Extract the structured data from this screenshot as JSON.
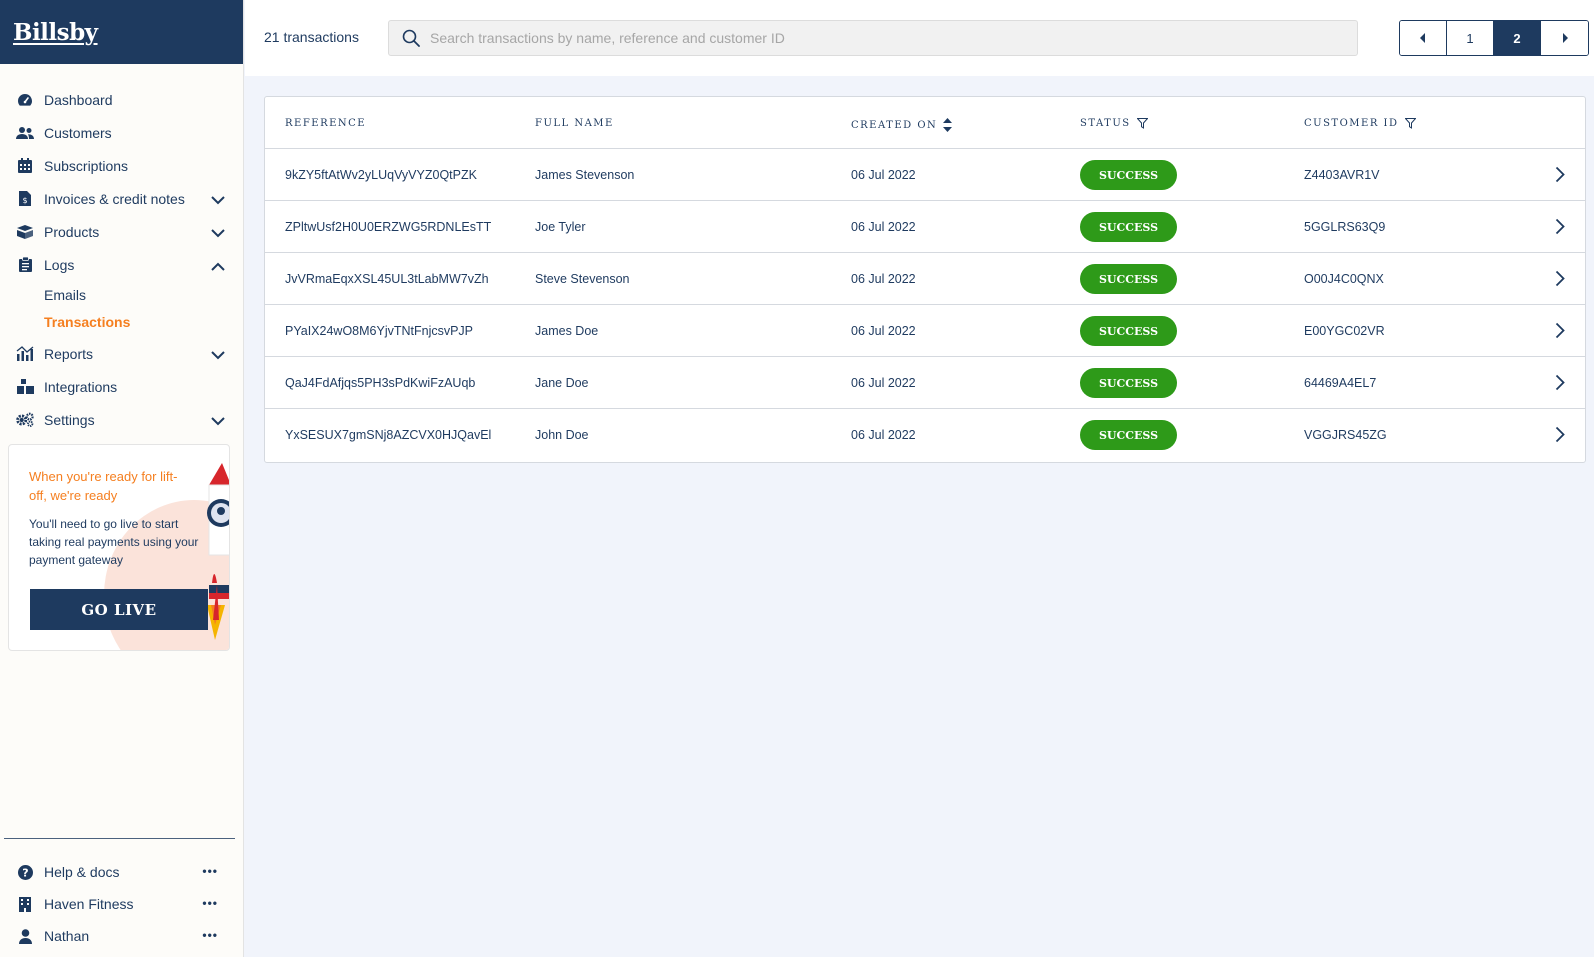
{
  "brand": {
    "name": "Billsby"
  },
  "sidebar": {
    "items": [
      {
        "label": "Dashboard",
        "icon": "dashboard-gauge-icon"
      },
      {
        "label": "Customers",
        "icon": "users-icon"
      },
      {
        "label": "Subscriptions",
        "icon": "calendar-icon"
      },
      {
        "label": "Invoices & credit notes",
        "icon": "invoice-icon",
        "expandable": true
      },
      {
        "label": "Products",
        "icon": "boxes-icon",
        "expandable": true
      },
      {
        "label": "Logs",
        "icon": "clipboard-icon",
        "expanded": true
      },
      {
        "label": "Reports",
        "icon": "chart-icon",
        "expandable": true
      },
      {
        "label": "Integrations",
        "icon": "puzzle-blocks-icon"
      },
      {
        "label": "Settings",
        "icon": "gears-icon",
        "expandable": true
      }
    ],
    "logs_sub": [
      {
        "label": "Emails",
        "active": false
      },
      {
        "label": "Transactions",
        "active": true
      }
    ],
    "promo": {
      "title": "When you're ready for lift-off, we're ready",
      "text": "You'll need to go live to start taking real payments using your payment gateway",
      "button": "GO LIVE"
    },
    "bottom": [
      {
        "label": "Help & docs",
        "icon": "question-circle-icon"
      },
      {
        "label": "Haven Fitness",
        "icon": "building-icon"
      },
      {
        "label": "Nathan",
        "icon": "user-icon"
      }
    ],
    "more_label": "•••"
  },
  "header": {
    "count_label": "21 transactions",
    "search_placeholder": "Search transactions by name, reference and customer ID",
    "pages": [
      "1",
      "2"
    ],
    "current_page": "2"
  },
  "table": {
    "columns": [
      "REFERENCE",
      "FULL NAME",
      "CREATED ON",
      "STATUS",
      "CUSTOMER ID"
    ],
    "rows": [
      {
        "reference": "9kZY5ftAtWv2yLUqVyVYZ0QtPZK",
        "name": "James Stevenson",
        "created": "06 Jul 2022",
        "status": "SUCCESS",
        "customer_id": "Z4403AVR1V"
      },
      {
        "reference": "ZPltwUsf2H0U0ERZWG5RDNLEsTT",
        "name": "Joe Tyler",
        "created": "06 Jul 2022",
        "status": "SUCCESS",
        "customer_id": "5GGLRS63Q9"
      },
      {
        "reference": "JvVRmaEqxXSL45UL3tLabMW7vZh",
        "name": "Steve Stevenson",
        "created": "06 Jul 2022",
        "status": "SUCCESS",
        "customer_id": "O00J4C0QNX"
      },
      {
        "reference": "PYaIX24wO8M6YjvTNtFnjcsvPJP",
        "name": "James Doe",
        "created": "06 Jul 2022",
        "status": "SUCCESS",
        "customer_id": "E00YGC02VR"
      },
      {
        "reference": "QaJ4FdAfjqs5PH3sPdKwiFzAUqb",
        "name": "Jane Doe",
        "created": "06 Jul 2022",
        "status": "SUCCESS",
        "customer_id": "64469A4EL7"
      },
      {
        "reference": "YxSESUX7gmSNj8AZCVX0HJQavEl",
        "name": "John Doe",
        "created": "06 Jul 2022",
        "status": "SUCCESS",
        "customer_id": "VGGJRS45ZG"
      }
    ]
  },
  "colors": {
    "navy": "#1e3a5f",
    "accent_orange": "#f57f20",
    "success_green": "#2e9a19",
    "background": "#f1f4fb"
  }
}
